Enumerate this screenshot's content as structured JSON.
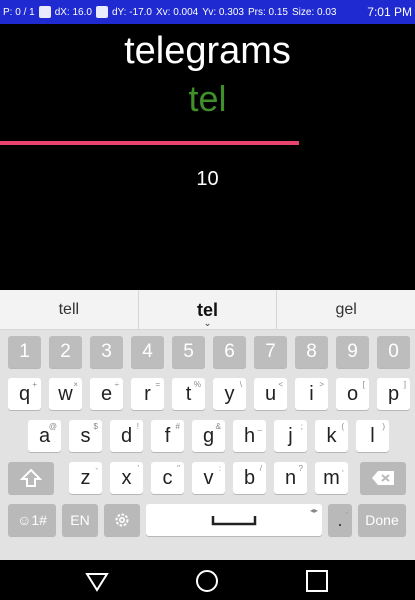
{
  "status_bar": {
    "p": "P: 0 / 1",
    "dx": "dX: 16.0",
    "dy": "dY: -17.0",
    "xv": "Xv: 0.004",
    "yv": "Yv: 0.303",
    "prs": "Prs: 0.15",
    "size": "Size: 0.03",
    "time": "7:01 PM"
  },
  "app": {
    "target_word": "telegrams",
    "typed_text": "tel",
    "progress_fraction": 0.72,
    "count": "10",
    "colors": {
      "typed": "#3f8f2a",
      "progress": "#e8436b"
    }
  },
  "keyboard": {
    "suggestions": [
      "tell",
      "tel",
      "gel"
    ],
    "number_row": [
      "1",
      "2",
      "3",
      "4",
      "5",
      "6",
      "7",
      "8",
      "9",
      "0"
    ],
    "row1": [
      {
        "k": "q",
        "h": "+"
      },
      {
        "k": "w",
        "h": "×"
      },
      {
        "k": "e",
        "h": "÷"
      },
      {
        "k": "r",
        "h": "="
      },
      {
        "k": "t",
        "h": "%"
      },
      {
        "k": "y",
        "h": "\\"
      },
      {
        "k": "u",
        "h": "<"
      },
      {
        "k": "i",
        "h": ">"
      },
      {
        "k": "o",
        "h": "["
      },
      {
        "k": "p",
        "h": "]"
      }
    ],
    "row2": [
      {
        "k": "a",
        "h": "@"
      },
      {
        "k": "s",
        "h": "$"
      },
      {
        "k": "d",
        "h": "!"
      },
      {
        "k": "f",
        "h": "#"
      },
      {
        "k": "g",
        "h": "&"
      },
      {
        "k": "h",
        "h": "_"
      },
      {
        "k": "j",
        "h": ";"
      },
      {
        "k": "k",
        "h": "("
      },
      {
        "k": "l",
        "h": ")"
      }
    ],
    "row3": [
      {
        "k": "z",
        "h": "-"
      },
      {
        "k": "x",
        "h": "'"
      },
      {
        "k": "c",
        "h": "\""
      },
      {
        "k": "v",
        "h": ":"
      },
      {
        "k": "b",
        "h": "/"
      },
      {
        "k": "n",
        "h": "?"
      },
      {
        "k": "m",
        "h": ","
      }
    ],
    "symbols_label": "☺1#",
    "language_label": "EN",
    "period": ".",
    "period_hint": ",",
    "done_label": "Done"
  }
}
